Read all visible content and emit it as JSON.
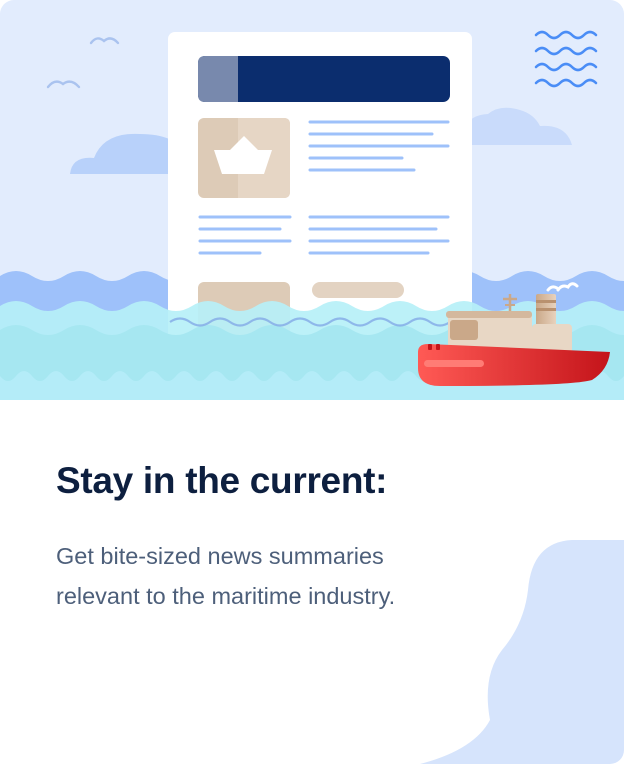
{
  "content": {
    "headline": "Stay in the current:",
    "body": "Get bite-sized news summaries relevant to the maritime industry."
  },
  "illustration": {
    "icons": [
      "cloud-icon",
      "bird-icon",
      "waves-icon",
      "newspaper-icon",
      "paper-boat-icon",
      "ship-icon"
    ]
  },
  "colors": {
    "sky": "#e2ecfd",
    "navy": "#0b2d6e",
    "text_dark": "#0d1f3f",
    "text_muted": "#4d5f7a",
    "wave_blue": "#9ec1fa",
    "wave_cyan": "#a8eaf4",
    "ship_red": "#e3322d",
    "blob": "#d6e4fc"
  }
}
